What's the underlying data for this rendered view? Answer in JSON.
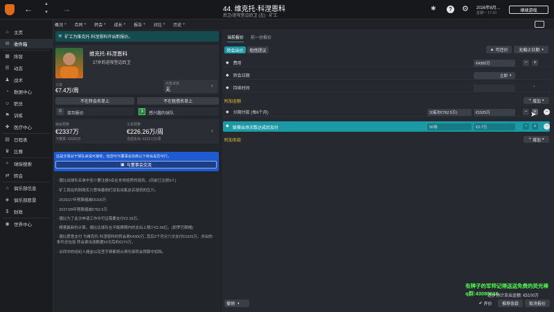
{
  "header": {
    "title": "44. 维克托·科涅恩科",
    "subtitle1": "后卫/进攻型边后卫 (左) · 矿工",
    "date": "2026年8月…",
    "date_sub": "星期一 17:10",
    "continue": "继续游戏"
  },
  "subtabs": [
    "概况",
    "合同",
    "转会",
    "成长",
    "报告",
    "对比",
    "历史"
  ],
  "nav": [
    {
      "icon": "⌂",
      "label": "主页"
    },
    {
      "icon": "✉",
      "label": "收件箱"
    },
    {
      "icon": "▦",
      "label": "阵容"
    },
    {
      "icon": "☰",
      "label": "动态"
    },
    {
      "icon": "♟",
      "label": "战术"
    },
    {
      "icon": "◔",
      "label": "数据中心"
    },
    {
      "icon": "☺",
      "label": "职员"
    },
    {
      "icon": "⚑",
      "label": "训练"
    },
    {
      "icon": "✚",
      "label": "医疗中心"
    },
    {
      "icon": "▤",
      "label": "日程表"
    },
    {
      "icon": "♛",
      "label": "比赛"
    },
    {
      "icon": "⌕",
      "label": "球探搜索"
    },
    {
      "icon": "⇄",
      "label": "转会"
    },
    {
      "icon": "⌂",
      "label": "俱乐部信息"
    },
    {
      "icon": "◈",
      "label": "俱乐部愿景"
    },
    {
      "icon": "$",
      "label": "财政"
    },
    {
      "icon": "◉",
      "label": "世界中心"
    }
  ],
  "notice": "矿工为维克托·科涅恩科开出新报价。",
  "player": {
    "name": "维克托·科涅恩科",
    "role": "27岁的进攻型边后卫",
    "wage_label": "工资",
    "wage": "€7.4万/周",
    "status_label": "出售状态",
    "status": "无",
    "btn_list_transfer": "不在转会名单上",
    "btn_list_loan": "不在租借名单上",
    "offers_count": "0",
    "offers_label": "接到报价",
    "interest_count": "3",
    "interest_label": "感兴趣的球队"
  },
  "budget": {
    "transfer_label": "转会预算",
    "transfer": "€2337万",
    "transfer_sub": "下赛季: €2050万",
    "wage_label": "工资预算",
    "wage": "€226.26万/周",
    "wage_sub": "当前支出: €222.1万/周"
  },
  "advice": {
    "text": "这是交易对于球队来说可接受，但您可与董事会协商以下转会是否可行。",
    "button": "与董事会交流"
  },
  "bullets": [
    "德比出球队名单中至少要注册5名在本地培养的球员。(目前已注册9人)",
    "矿工现在的财政实力意味着他们没有出售这名球员的压力。",
    "2026/27年预算缩减€5100万",
    "2027/28年预算缩减€762.5万",
    "德比为了此次申请工作许可证需要支付€2.35万。",
    "根据最新的计算，德比比球队在平衡赛期内的支出上限少€2.56亿。(即罗巴斯帽)",
    "德比愿意支付 为维克托·科涅恩科的转会费€4300万, 其后2个月分六次支付€1525万。并出的条件还包括 转会费出涨数据50次后的€270万。",
    "合同中的经纪人佣金以及签字费都将从俱乐部转会预算中扣除。"
  ],
  "bottom_left": {
    "label": "撤销"
  },
  "tabs": [
    "当前报价",
    "前一份报价"
  ],
  "toggles": [
    "转会出价",
    "租借提议"
  ],
  "controls": {
    "can_offer": "可还价",
    "deadline": "无截止日期"
  },
  "offer": {
    "fee_label": "费用",
    "fee_value": "€4300万",
    "date_label": "转会日期",
    "date_value": "立即",
    "duration_label": "持续时间",
    "extra_header": "附加金额",
    "installment_label": "分期付款 (每6个月)",
    "installment_count": "2(每次€762.5万)",
    "installment_value": "€1525万",
    "clause_label": "联赛出场次数达成后加付",
    "clause_count": "50场",
    "clause_value": "€2.7万",
    "add_label": "增加",
    "conditions_header": "附加条款"
  },
  "footer": {
    "overlay_line1": "有牌子的军师记得送送免费的荧光棒",
    "overlay_line2": "q群:43088616",
    "fee_info": "逐步预计支出金额: €5100万",
    "confirm": "开价",
    "recommend": "推荐条款",
    "cancel": "取消报价"
  },
  "colors": {
    "accent": "#1b9aa6",
    "notice": "#134b4f",
    "advice": "#1f5bd0"
  }
}
